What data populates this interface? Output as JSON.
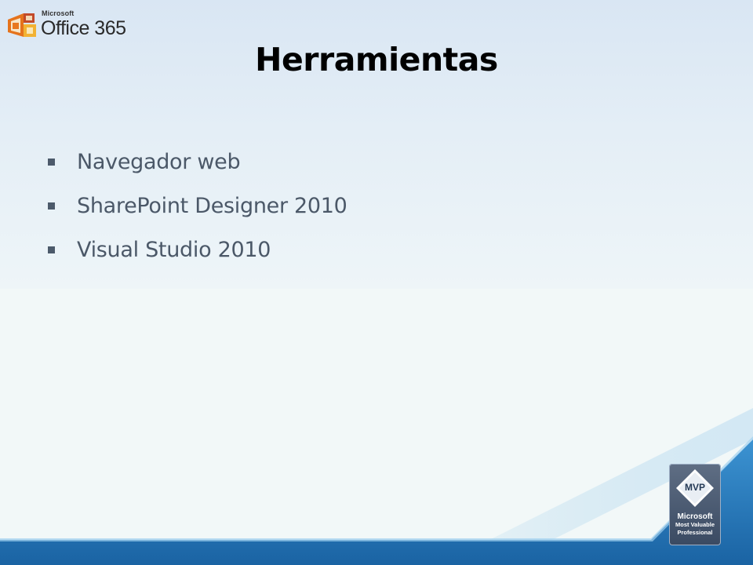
{
  "logo": {
    "brand": "Microsoft",
    "product": "Office 365",
    "mark_colors": [
      "#e8781f",
      "#b8452a",
      "#f2b233"
    ]
  },
  "slide": {
    "title": "Herramientas",
    "bullets": [
      "Navegador web",
      "SharePoint Designer 2010",
      "Visual Studio 2010"
    ],
    "bullet_icon": "square-bullet-icon",
    "text_color": "#4b5868",
    "title_color": "#000000"
  },
  "footer": {
    "bar_color": "#1f75b9",
    "highlight_color": "#3b93d3"
  },
  "badge": {
    "label": "MVP",
    "line1": "Microsoft",
    "line2": "Most Valuable",
    "line3": "Professional",
    "badge_color": "#46566e"
  }
}
